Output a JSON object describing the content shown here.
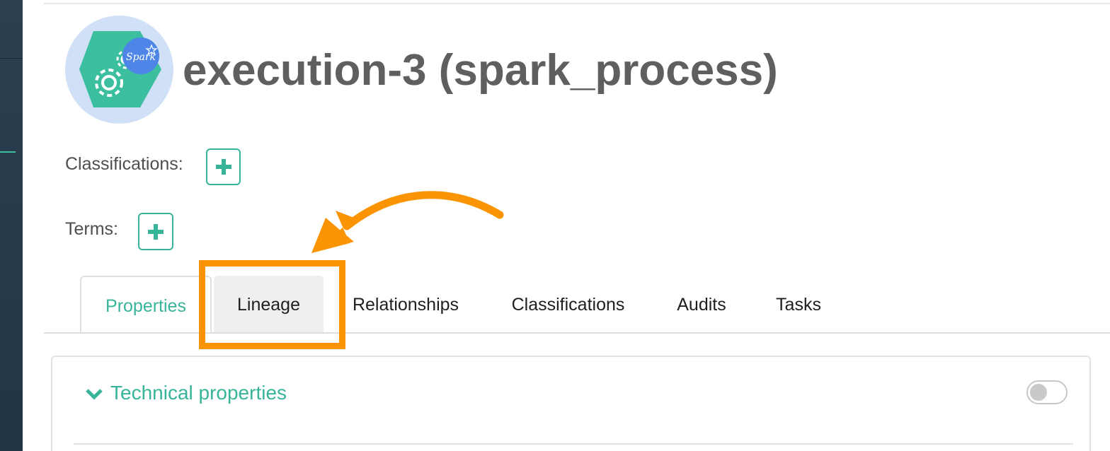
{
  "entity": {
    "title": "execution-3 (spark_process)",
    "icon": "spark-process-gear-icon",
    "badge_text": "Spark"
  },
  "classifications": {
    "label": "Classifications:"
  },
  "terms": {
    "label": "Terms:"
  },
  "tabs": [
    {
      "label": "Properties",
      "state": "active"
    },
    {
      "label": "Lineage",
      "state": "hover"
    },
    {
      "label": "Relationships",
      "state": "default"
    },
    {
      "label": "Classifications",
      "state": "default"
    },
    {
      "label": "Audits",
      "state": "default"
    },
    {
      "label": "Tasks",
      "state": "default"
    }
  ],
  "panel": {
    "title": "Technical properties",
    "expanded": true,
    "toggle_on": false
  },
  "annotation": {
    "highlight_target": "Lineage tab",
    "color": "#fb9402"
  },
  "colors": {
    "accent": "#38b49a",
    "sidebar": "#2c3f51",
    "title": "#5f5f5f"
  }
}
